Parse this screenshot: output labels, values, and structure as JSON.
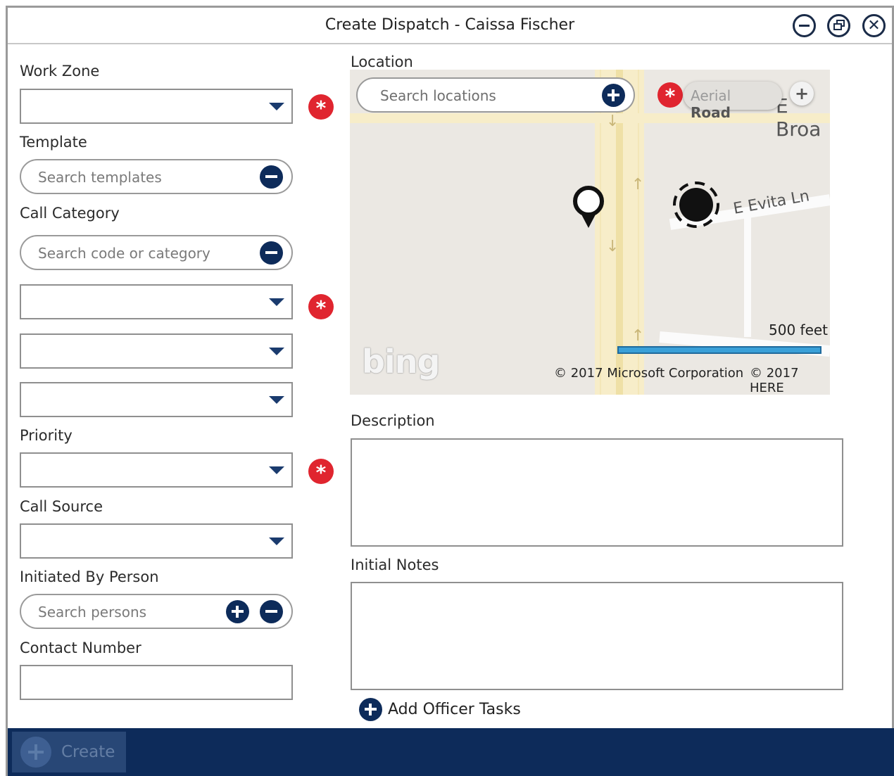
{
  "window": {
    "title": "Create Dispatch - Caissa Fischer",
    "controls": [
      "minimize-icon",
      "restore-icon",
      "close-icon"
    ]
  },
  "form": {
    "work_zone": {
      "label": "Work Zone",
      "value": "",
      "required": true
    },
    "template": {
      "label": "Template",
      "placeholder": "Search templates"
    },
    "call_category": {
      "label": "Call Category",
      "placeholder": "Search code or category",
      "dropdown_1": {
        "value": "",
        "required": true
      },
      "dropdown_2": {
        "value": ""
      },
      "dropdown_3": {
        "value": ""
      }
    },
    "priority": {
      "label": "Priority",
      "value": "",
      "required": true
    },
    "call_source": {
      "label": "Call Source",
      "value": ""
    },
    "initiated_by": {
      "label": "Initiated By Person",
      "placeholder": "Search persons"
    },
    "contact_number": {
      "label": "Contact Number",
      "value": ""
    }
  },
  "location": {
    "label": "Location",
    "search_placeholder": "Search locations",
    "required": true,
    "map": {
      "type_toggle": {
        "aerial": "Aerial",
        "road": "Road",
        "selected": "Road"
      },
      "zoom_label": "+",
      "streets": {
        "evita": "E Evita Ln",
        "broadway_partial": "E Broa"
      },
      "scale_label": "500 feet",
      "copyright_microsoft": "© 2017 Microsoft Corporation",
      "copyright_here": "© 2017 HERE",
      "logo": "bing"
    }
  },
  "description": {
    "label": "Description",
    "value": ""
  },
  "initial_notes": {
    "label": "Initial Notes",
    "value": ""
  },
  "add_officer_tasks": {
    "label": "Add Officer Tasks"
  },
  "footer": {
    "create_label": "Create"
  },
  "colors": {
    "accent": "#0d2b5a",
    "required": "#e0252f",
    "footer_bg": "#0d2b5a",
    "scale_bar": "#3aa0d8"
  }
}
